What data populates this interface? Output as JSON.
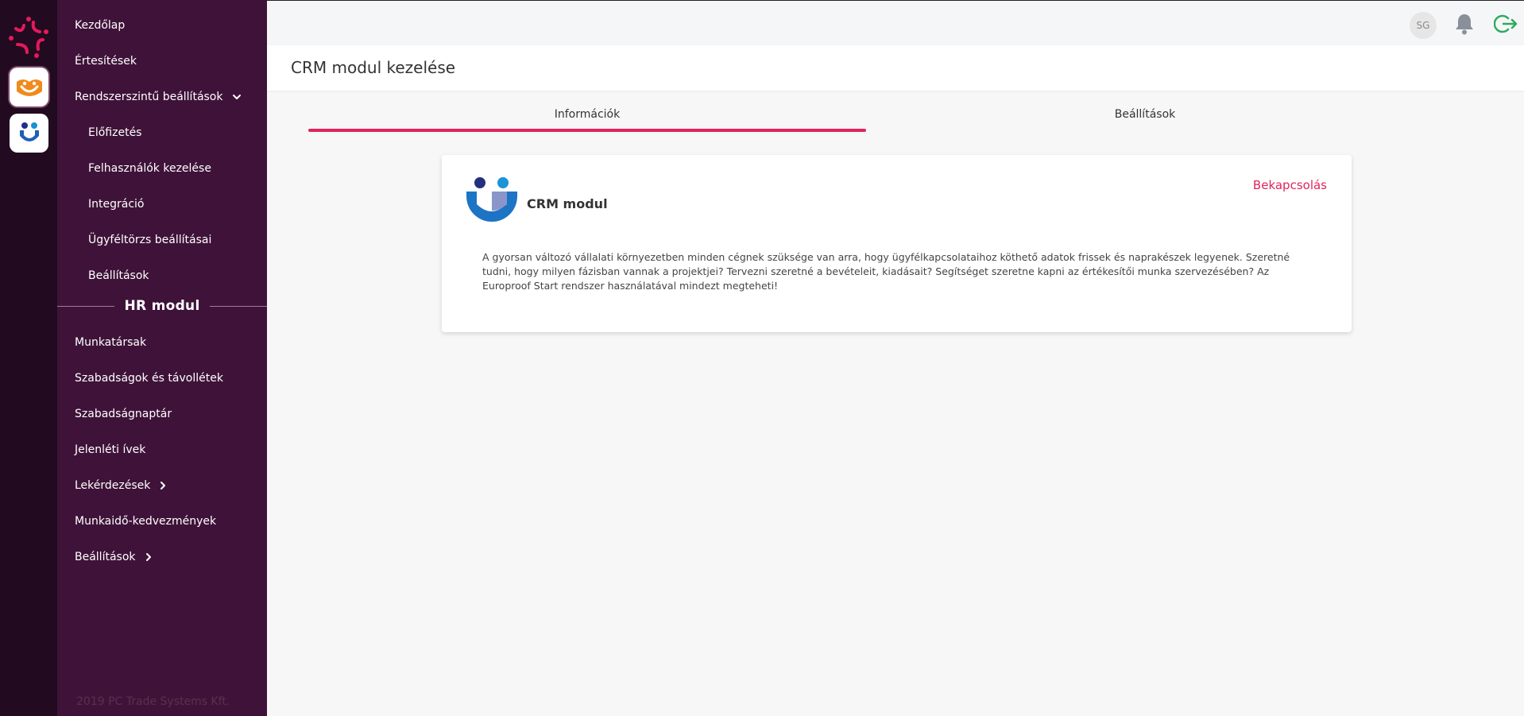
{
  "rail": {
    "apps": [
      {
        "name": "Europroof Start"
      },
      {
        "name": "CRM"
      }
    ]
  },
  "sidebar": {
    "items": [
      {
        "label": "Kezdőlap"
      },
      {
        "label": "Értesítések"
      },
      {
        "label": "Rendszerszintű beállítások",
        "expanded": true
      },
      {
        "label": "Előfizetés"
      },
      {
        "label": "Felhasználók kezelése"
      },
      {
        "label": "Integráció"
      },
      {
        "label": "Ügyféltörzs beállításai"
      },
      {
        "label": "Beállítások"
      }
    ],
    "section_title": "HR modul",
    "hr_items": [
      {
        "label": "Munkatársak"
      },
      {
        "label": "Szabadságok és távollétek"
      },
      {
        "label": "Szabadságnaptár"
      },
      {
        "label": "Jelenléti ívek"
      },
      {
        "label": "Lekérdezések"
      },
      {
        "label": "Munkaidő-kedvezmények"
      },
      {
        "label": "Beállítások"
      }
    ],
    "copyright": "2019 PC Trade Systems Kft."
  },
  "topbar": {
    "avatar_initials": "SG",
    "icons": [
      "bell-icon",
      "logout-icon"
    ]
  },
  "page": {
    "title": "CRM modul kezelése"
  },
  "tabs": [
    {
      "label": "Információk",
      "active": true
    },
    {
      "label": "Beállítások",
      "active": false
    }
  ],
  "card": {
    "module_name": "CRM modul",
    "action_label": "Bekapcsolás",
    "description": "A gyorsan változó vállalati környezetben minden cégnek szüksége van arra, hogy ügyfélkapcsolataihoz köthető adatok frissek és naprakészek legyenek. Szeretné tudni, hogy milyen fázisban vannak a projektjei? Tervezni szeretné a bevételeit, kiadásait? Segítséget szeretne kapni az értékesítői munka szervezésében? Az Europroof Start rendszer használatával mindezt megteheti!"
  },
  "colors": {
    "accent": "#e0245e",
    "sidebar_bg": "#3f1339",
    "rail_bg": "#220a20",
    "logout_green": "#2eaa5b"
  }
}
